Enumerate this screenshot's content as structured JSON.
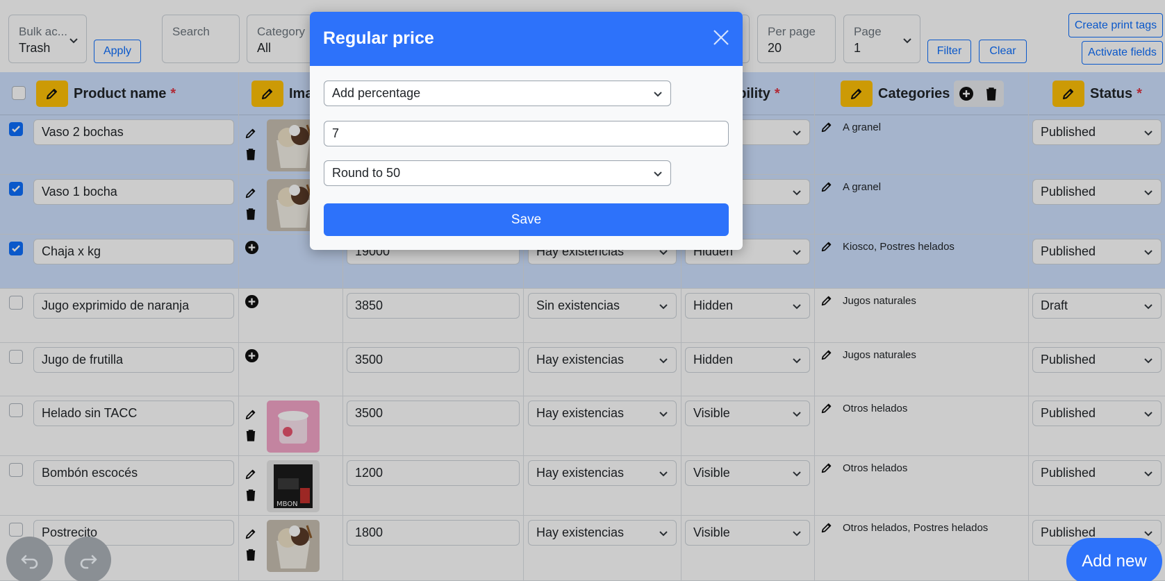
{
  "toolbar": {
    "bulk": {
      "label": "Bulk ac...",
      "value": "Trash"
    },
    "apply": "Apply",
    "search": {
      "label": "Search",
      "value": ""
    },
    "category": {
      "label": "Category",
      "value": "All"
    },
    "per_page": {
      "label": "Per page",
      "value": "20"
    },
    "page": {
      "label": "Page",
      "value": "1"
    },
    "filter": "Filter",
    "clear": "Clear",
    "create_print_tags": "Create print tags",
    "activate_fields": "Activate fields"
  },
  "table": {
    "headers": {
      "product_name": "Product name",
      "image": "Ima",
      "visibility": "isibility",
      "categories": "Categories",
      "status": "Status",
      "required_mark": "*"
    },
    "rows": [
      {
        "checked": true,
        "name": "Vaso 2 bochas",
        "has_image": true,
        "image_icon": "ice-cream-cup-photo",
        "price": "",
        "stock": "",
        "visibility": "",
        "categories": "A granel",
        "status": "Published"
      },
      {
        "checked": true,
        "name": "Vaso 1 bocha",
        "has_image": true,
        "image_icon": "ice-cream-cup-photo",
        "price": "",
        "stock": "",
        "visibility": "",
        "categories": "A granel",
        "status": "Published"
      },
      {
        "checked": true,
        "name": "Chaja x kg",
        "has_image": false,
        "price": "19000",
        "stock": "Hay existencias",
        "visibility": "Hidden",
        "categories": "Kiosco, Postres helados",
        "status": "Published"
      },
      {
        "checked": false,
        "name": "Jugo exprimido de naranja",
        "has_image": false,
        "price": "3850",
        "stock": "Sin existencias",
        "visibility": "Hidden",
        "categories": "Jugos naturales",
        "status": "Draft"
      },
      {
        "checked": false,
        "name": "Jugo de frutilla",
        "has_image": false,
        "price": "3500",
        "stock": "Hay existencias",
        "visibility": "Hidden",
        "categories": "Jugos naturales",
        "status": "Published"
      },
      {
        "checked": false,
        "name": "Helado sin TACC",
        "has_image": true,
        "image_icon": "pink-ice-cream-tub-photo",
        "price": "3500",
        "stock": "Hay existencias",
        "visibility": "Visible",
        "categories": "Otros helados",
        "status": "Published"
      },
      {
        "checked": false,
        "name": "Bombón escocés",
        "has_image": true,
        "image_icon": "dark-box-photo",
        "price": "1200",
        "stock": "Hay existencias",
        "visibility": "Visible",
        "categories": "Otros helados",
        "status": "Published"
      },
      {
        "checked": false,
        "name": "Postrecito",
        "has_image": true,
        "image_icon": "ice-cream-cup-photo",
        "price": "1800",
        "stock": "Hay existencias",
        "visibility": "Visible",
        "categories": "Otros helados, Postres helados",
        "status": "Published"
      }
    ]
  },
  "modal": {
    "title": "Regular price",
    "operation": "Add percentage",
    "amount": "7",
    "rounding": "Round to 50",
    "save": "Save"
  },
  "floating": {
    "add_new": "Add new"
  },
  "colors": {
    "primary": "#2d72fa",
    "selected_row": "#cfe2ff",
    "edit_yellow": "#ffc107",
    "required_red": "#dc3545"
  }
}
